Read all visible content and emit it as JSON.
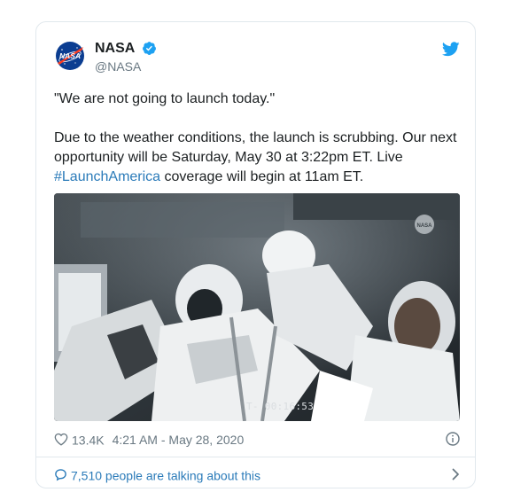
{
  "tweet": {
    "author": {
      "display_name": "NASA",
      "handle": "@NASA",
      "verified": true,
      "avatar_icon": "nasa-meatball-logo"
    },
    "text": {
      "quote": "\"We are not going to launch today.\"",
      "body_before_hashtag": "Due to the weather conditions, the launch is scrubbing. Our next opportunity will be Saturday, May 30 at 3:22pm ET. Live ",
      "hashtag": "#LaunchAmerica",
      "body_after_hashtag": " coverage will begin at 11am ET."
    },
    "media": {
      "timecode": "T- 00:16:53",
      "watermark_icon": "nasa-logo"
    },
    "meta": {
      "likes": "13.4K",
      "timestamp": "4:21 AM - May 28, 2020"
    },
    "footer": {
      "talking_about": "7,510 people are talking about this"
    }
  },
  "colors": {
    "text": "#1c2022",
    "secondary": "#697882",
    "link": "#2b7bb9",
    "twitter_blue": "#1da1f2",
    "border": "#e1e8ed",
    "nasa_blue": "#0b3d91",
    "nasa_red": "#fc3d21"
  }
}
